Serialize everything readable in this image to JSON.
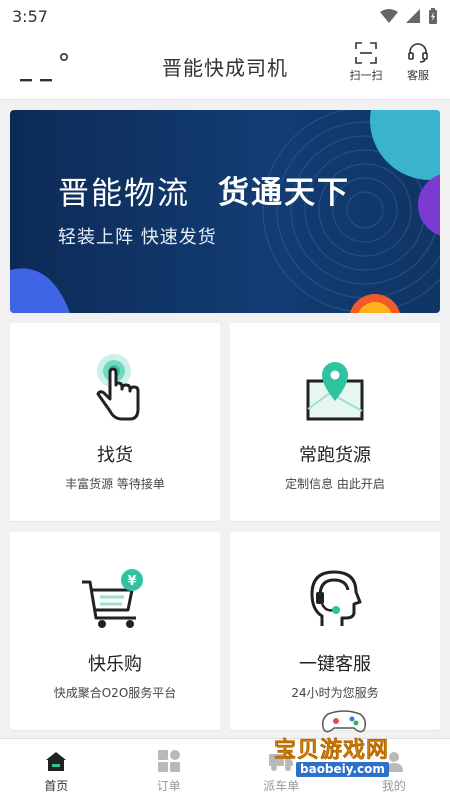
{
  "status_bar": {
    "time": "3:57"
  },
  "header": {
    "title": "晋能快成司机",
    "scan_label": "扫一扫",
    "service_label": "客服"
  },
  "banner": {
    "title": "晋能物流",
    "title_bold": "货通天下",
    "subtitle": "轻装上阵  快速发货"
  },
  "cards": [
    {
      "title": "找货",
      "subtitle": "丰富货源 等待接单",
      "icon": "hand-tap-icon"
    },
    {
      "title": "常跑货源",
      "subtitle": "定制信息 由此开启",
      "icon": "map-pin-icon"
    },
    {
      "title": "快乐购",
      "subtitle": "快成聚合O2O服务平台",
      "icon": "shopping-cart-icon"
    },
    {
      "title": "一键客服",
      "subtitle": "24小时为您服务",
      "icon": "headset-person-icon"
    }
  ],
  "tabs": [
    {
      "label": "首页",
      "icon": "home-icon",
      "active": true
    },
    {
      "label": "订单",
      "icon": "grid-icon",
      "active": false
    },
    {
      "label": "派车单",
      "icon": "truck-icon",
      "active": false
    },
    {
      "label": "我的",
      "icon": "person-icon",
      "active": false
    }
  ],
  "watermark": {
    "text": "宝贝游戏网",
    "url": "baobeiy.com"
  },
  "colors": {
    "accent": "#2ec4a0",
    "banner_bg": "#123d74",
    "dark": "#222222"
  }
}
